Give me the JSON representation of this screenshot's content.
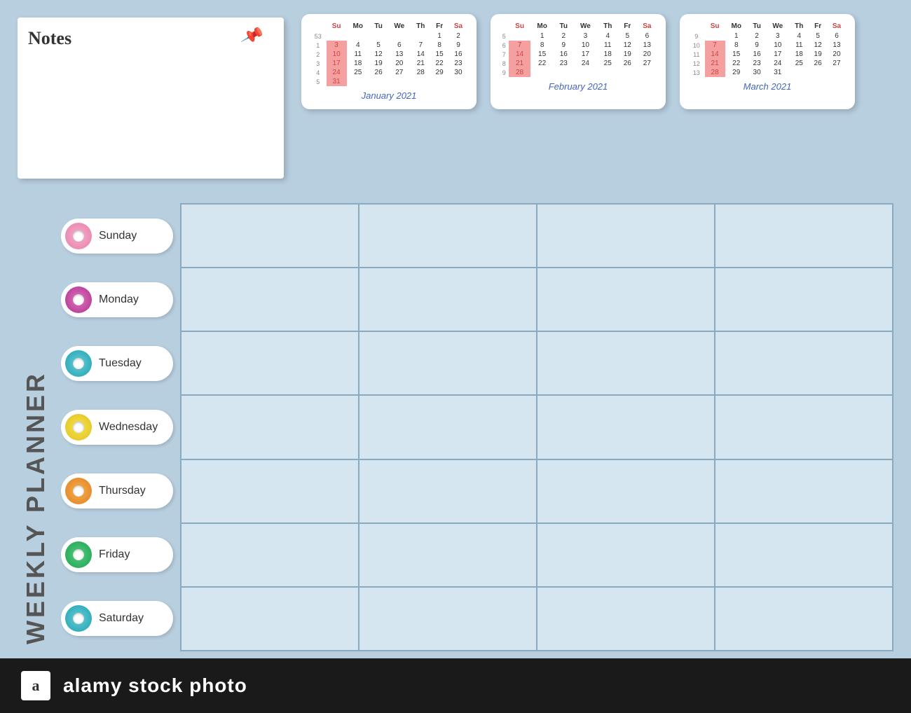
{
  "notes": {
    "title": "Notes"
  },
  "calendars": [
    {
      "month_label": "January 2021",
      "headers": [
        "Su",
        "Mo",
        "Tu",
        "We",
        "Th",
        "Fr",
        "Sa"
      ],
      "weeks": [
        {
          "num": "53",
          "days": [
            "",
            "",
            "",
            "",
            "",
            "1",
            "2"
          ]
        },
        {
          "num": "1",
          "days": [
            "3",
            "4",
            "5",
            "6",
            "7",
            "8",
            "9"
          ]
        },
        {
          "num": "2",
          "days": [
            "10",
            "11",
            "12",
            "13",
            "14",
            "15",
            "16"
          ]
        },
        {
          "num": "3",
          "days": [
            "17",
            "18",
            "19",
            "20",
            "21",
            "22",
            "23"
          ]
        },
        {
          "num": "4",
          "days": [
            "24",
            "25",
            "26",
            "27",
            "28",
            "29",
            "30"
          ]
        },
        {
          "num": "5",
          "days": [
            "31",
            "",
            "",
            "",
            "",
            "",
            ""
          ]
        }
      ],
      "highlight_col": 0
    },
    {
      "month_label": "February 2021",
      "headers": [
        "Su",
        "Mo",
        "Tu",
        "We",
        "Th",
        "Fr",
        "Sa"
      ],
      "weeks": [
        {
          "num": "5",
          "days": [
            "",
            "1",
            "2",
            "3",
            "4",
            "5",
            "6"
          ]
        },
        {
          "num": "6",
          "days": [
            "7",
            "8",
            "9",
            "10",
            "11",
            "12",
            "13"
          ]
        },
        {
          "num": "7",
          "days": [
            "14",
            "15",
            "16",
            "17",
            "18",
            "19",
            "20"
          ]
        },
        {
          "num": "8",
          "days": [
            "21",
            "22",
            "23",
            "24",
            "25",
            "26",
            "27"
          ]
        },
        {
          "num": "9",
          "days": [
            "28",
            "",
            "",
            "",
            "",
            "",
            ""
          ]
        }
      ],
      "highlight_col": 0
    },
    {
      "month_label": "March 2021",
      "headers": [
        "Su",
        "Mo",
        "Tu",
        "We",
        "Th",
        "Fr",
        "Sa"
      ],
      "weeks": [
        {
          "num": "9",
          "days": [
            "",
            "1",
            "2",
            "3",
            "4",
            "5",
            "6"
          ]
        },
        {
          "num": "10",
          "days": [
            "7",
            "8",
            "9",
            "10",
            "11",
            "12",
            "13"
          ]
        },
        {
          "num": "11",
          "days": [
            "14",
            "15",
            "16",
            "17",
            "18",
            "19",
            "20"
          ]
        },
        {
          "num": "12",
          "days": [
            "21",
            "22",
            "23",
            "24",
            "25",
            "26",
            "27"
          ]
        },
        {
          "num": "13",
          "days": [
            "28",
            "29",
            "30",
            "31",
            "",
            "",
            ""
          ]
        }
      ],
      "highlight_col": 0
    }
  ],
  "weekly_planner": {
    "title": "WEEKLY PLANNER",
    "days": [
      {
        "name": "Sunday",
        "color": "#e87da8",
        "gradient": "radial-gradient(circle, #f0a0c0 30%, #e87da8 100%)"
      },
      {
        "name": "Monday",
        "color": "#b03090",
        "gradient": "radial-gradient(circle, #d060b0 30%, #b03090 100%)"
      },
      {
        "name": "Tuesday",
        "color": "#20a0b0",
        "gradient": "radial-gradient(circle, #50c0cc 30%, #20a0b0 100%)"
      },
      {
        "name": "Wednesday",
        "color": "#e0c020",
        "gradient": "radial-gradient(circle, #f0d840 30%, #e0c020 100%)"
      },
      {
        "name": "Thursday",
        "color": "#e08020",
        "gradient": "radial-gradient(circle, #f0a040 30%, #e08020 100%)"
      },
      {
        "name": "Friday",
        "color": "#20a050",
        "gradient": "radial-gradient(circle, #40c070 30%, #20a050 100%)"
      },
      {
        "name": "Saturday",
        "color": "#20a0b0",
        "gradient": "radial-gradient(circle, #50c0cc 30%, #20a0b0 100%)"
      }
    ],
    "grid_rows": 7,
    "grid_cols": 4
  },
  "footer": {
    "logo_letter": "a",
    "brand": "alamy stock photo"
  }
}
